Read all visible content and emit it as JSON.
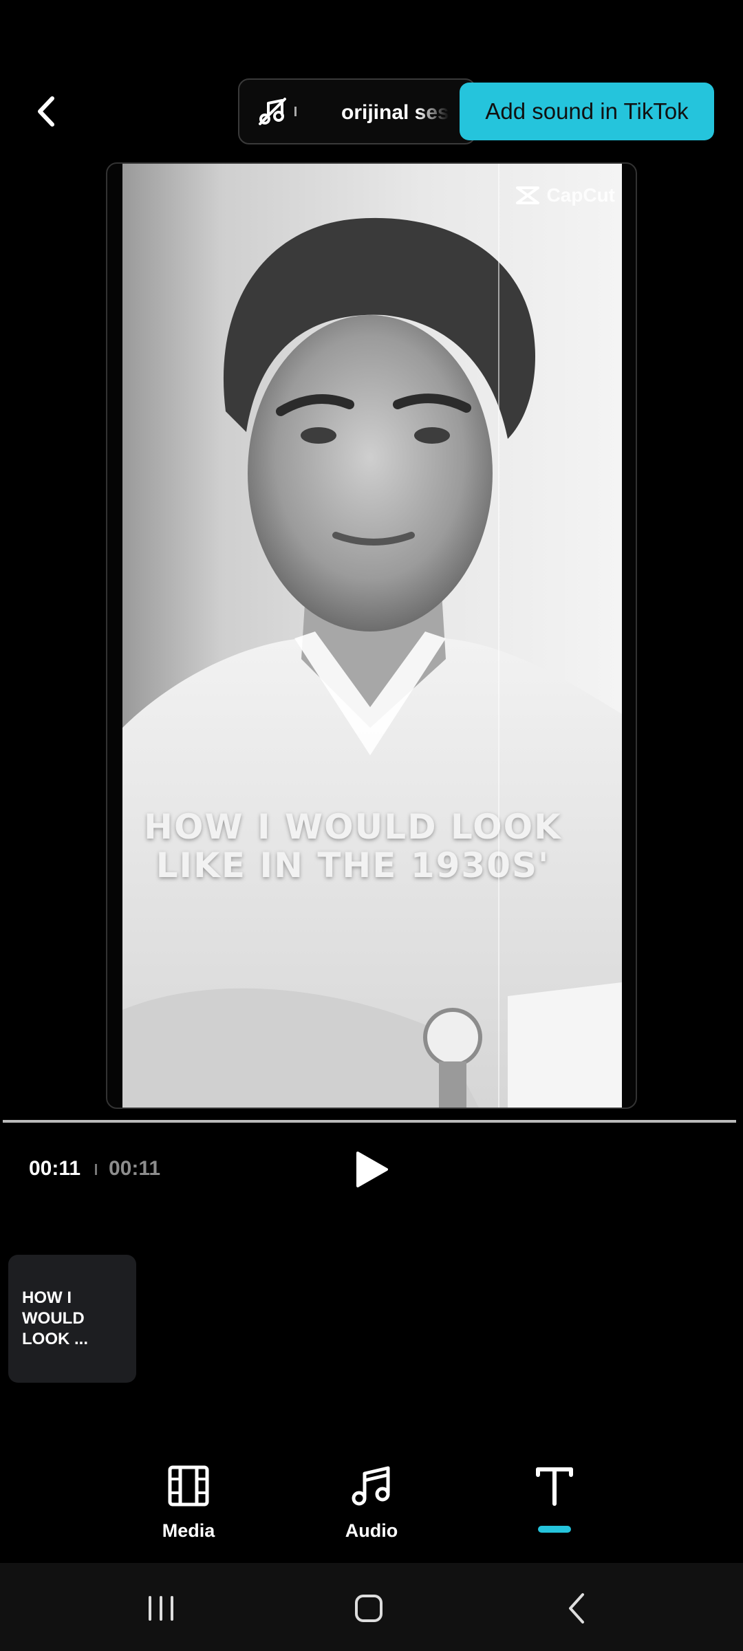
{
  "header": {
    "back_icon": "chevron-left-icon",
    "sound": {
      "icon": "music-note-off-icon",
      "name": "orijinal ses"
    },
    "add_sound_label": "Add sound in TikTok",
    "accent_color": "#25c4dc"
  },
  "preview": {
    "watermark": "CapCut",
    "overlay_text_line1": "HOW I WOULD LOOK",
    "overlay_text_line2": "LIKE IN THE 1930S'",
    "progress": 1.0
  },
  "playback": {
    "current_time": "00:11",
    "total_time": "00:11",
    "play_icon": "play-icon"
  },
  "timeline": {
    "text_clip_label": "HOW I WOULD LOOK ..."
  },
  "tabs": [
    {
      "label": "Media",
      "icon": "film-icon"
    },
    {
      "label": "Audio",
      "icon": "music-note-icon"
    },
    {
      "label": "",
      "icon": "text-icon",
      "active": true
    }
  ],
  "system_nav": {
    "recents_icon": "recents-icon",
    "home_icon": "home-icon",
    "back_icon": "back-icon"
  }
}
